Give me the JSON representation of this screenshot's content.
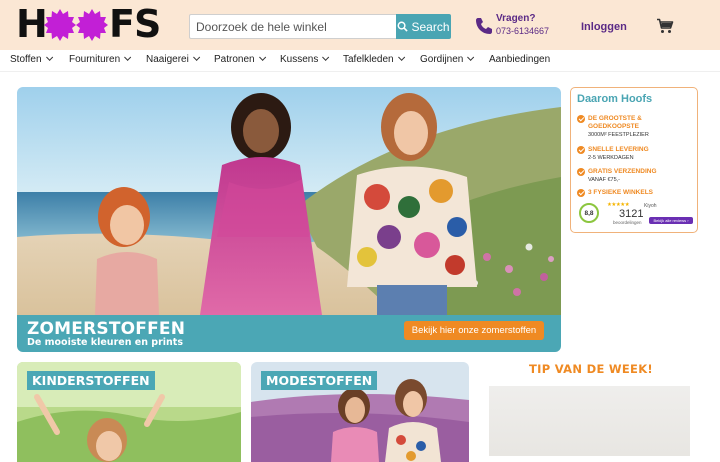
{
  "header": {
    "logo_text": "HOOFS",
    "search": {
      "placeholder": "Doorzoek de hele winkel",
      "button_label": "Search"
    },
    "contact": {
      "label": "Vragen?",
      "phone": "073-6134667"
    },
    "login_label": "Inloggen",
    "cart_icon": "cart-icon"
  },
  "nav": {
    "items": [
      {
        "label": "Stoffen",
        "has_dropdown": true
      },
      {
        "label": "Fournituren",
        "has_dropdown": true
      },
      {
        "label": "Naaigerei",
        "has_dropdown": true
      },
      {
        "label": "Patronen",
        "has_dropdown": true
      },
      {
        "label": "Kussens",
        "has_dropdown": true
      },
      {
        "label": "Tafelkleden",
        "has_dropdown": true
      },
      {
        "label": "Gordijnen",
        "has_dropdown": true
      },
      {
        "label": "Aanbiedingen",
        "has_dropdown": false
      }
    ]
  },
  "hero": {
    "title": "ZOMERSTOFFEN",
    "subtitle": "De mooiste kleuren en prints",
    "cta_label": "Bekijk hier onze zomerstoffen"
  },
  "sidebar": {
    "title": "Daarom Hoofs",
    "usps": [
      {
        "title": "DE GROOTSTE & GOEDKOOPSTE",
        "detail": "3000M² FEESTPLEZIER"
      },
      {
        "title": "SNELLE LEVERING",
        "detail": "2-5 WERKDAGEN"
      },
      {
        "title": "GRATIS VERZENDING",
        "detail": "VANAF €75,-"
      },
      {
        "title": "3 FYSIEKE WINKELS",
        "detail": ""
      }
    ],
    "review": {
      "score": "8,8",
      "stars": "★★★★★",
      "brand": "Kiyoh",
      "count": "3121",
      "count_label": "beoordelingen",
      "button_label": "Bekijk alle reviews ›"
    }
  },
  "categories": [
    {
      "label": "KINDERSTOFFEN"
    },
    {
      "label": "MODESTOFFEN"
    }
  ],
  "tip": {
    "title": "TIP VAN DE WEEK!"
  },
  "colors": {
    "header_bg": "#fbe7d4",
    "teal": "#4ba7b5",
    "orange": "#ef8a23",
    "purple": "#5b2a86",
    "logo_magenta": "#c21fd6"
  }
}
